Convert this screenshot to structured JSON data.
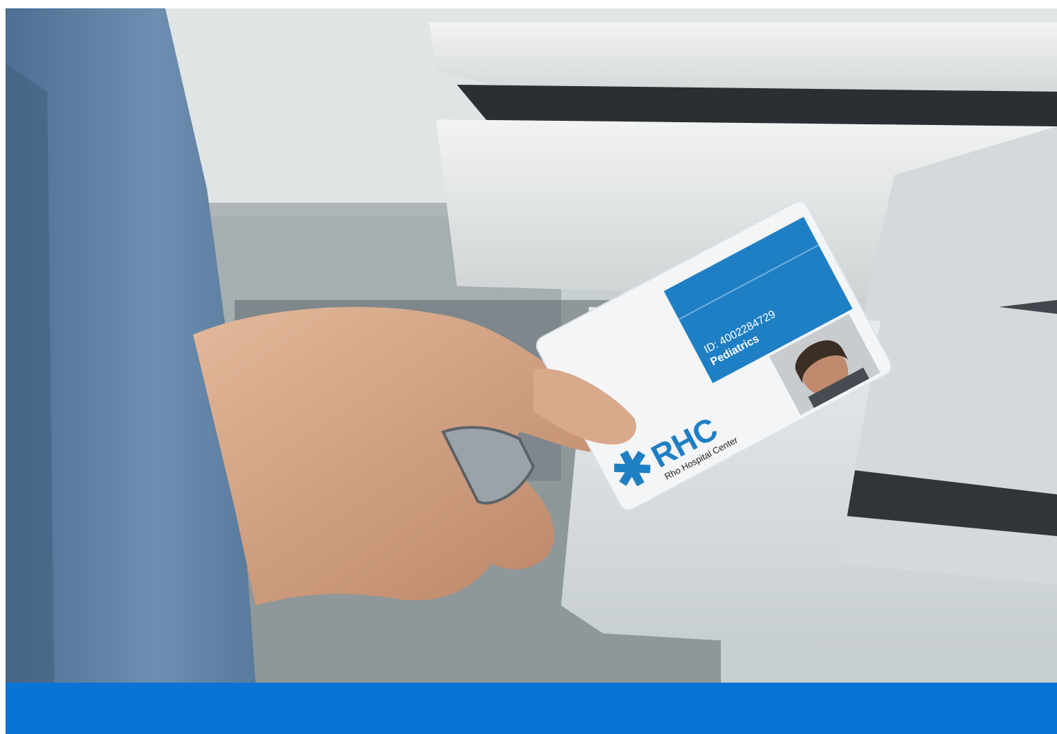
{
  "photo": {
    "badge": {
      "logo_text": "RHC",
      "org_name": "Rho Hospital Center",
      "id_line": "ID: 4002284729",
      "department": "Pediatrics",
      "accent_color": "#1f7fc4"
    }
  },
  "band": {
    "color": "#0a74d6"
  }
}
